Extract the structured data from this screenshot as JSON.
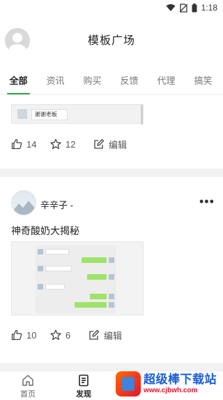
{
  "status_bar": {
    "time": "1:18"
  },
  "header": {
    "title": "模板广场"
  },
  "tabs": [
    {
      "label": "全部",
      "active": true
    },
    {
      "label": "资讯",
      "active": false
    },
    {
      "label": "购买",
      "active": false
    },
    {
      "label": "反馈",
      "active": false
    },
    {
      "label": "代理",
      "active": false
    },
    {
      "label": "搞笑",
      "active": false
    }
  ],
  "posts": [
    {
      "image_caption": "谢谢老板",
      "likes": "14",
      "favorites": "12",
      "edit_label": "编辑"
    },
    {
      "author": "辛辛子 -",
      "title": "神奇酸奶大揭秘",
      "likes": "10",
      "favorites": "6",
      "edit_label": "编辑"
    }
  ],
  "bottom_nav": [
    {
      "label": "首页",
      "icon": "home-icon",
      "active": false
    },
    {
      "label": "发现",
      "icon": "discover-icon",
      "active": true
    }
  ],
  "watermark": {
    "title": "超级棒下载站",
    "url": "www.cjbwh.com"
  },
  "colors": {
    "accent": "#2aa843",
    "divider": "#f2f2f2"
  }
}
